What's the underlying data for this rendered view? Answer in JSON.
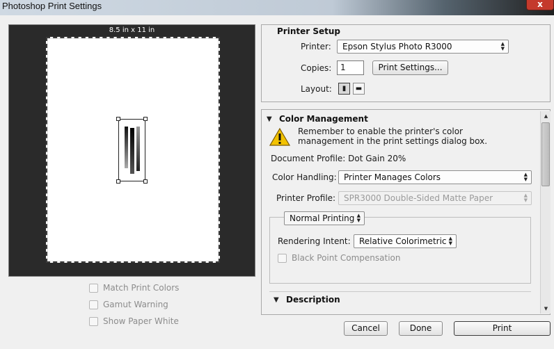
{
  "window": {
    "title": "Photoshop Print Settings",
    "close_label": "x"
  },
  "preview": {
    "paper_size": "8.5 in x 11 in"
  },
  "preview_options": [
    {
      "label": "Match Print Colors",
      "checked": false,
      "enabled": false
    },
    {
      "label": "Gamut Warning",
      "checked": false,
      "enabled": false
    },
    {
      "label": "Show Paper White",
      "checked": false,
      "enabled": false
    }
  ],
  "printer_setup": {
    "heading": "Printer Setup",
    "printer_label": "Printer:",
    "printer_value": "Epson Stylus Photo R3000",
    "copies_label": "Copies:",
    "copies_value": "1",
    "print_settings_button": "Print Settings...",
    "layout_label": "Layout:",
    "layout_icons": [
      "portrait-layout-icon",
      "landscape-layout-icon"
    ]
  },
  "color_management": {
    "heading": "Color Management",
    "warning_line1": "Remember to enable the printer's color",
    "warning_line2": "management in the print settings dialog box.",
    "document_profile": "Document Profile: Dot Gain 20%",
    "color_handling_label": "Color Handling:",
    "color_handling_value": "Printer Manages Colors",
    "printer_profile_label": "Printer Profile:",
    "printer_profile_value": "SPR3000 Double-Sided Matte Paper",
    "printing_mode": "Normal Printing",
    "rendering_intent_label": "Rendering Intent:",
    "rendering_intent_value": "Relative Colorimetric",
    "black_point_label": "Black Point Compensation"
  },
  "description": {
    "heading": "Description"
  },
  "footer": {
    "cancel": "Cancel",
    "done": "Done",
    "print": "Print"
  },
  "colors": {
    "preview_bg": "#2a2a2a",
    "warning_yellow": "#f2c200",
    "close_red": "#c43a2c"
  }
}
